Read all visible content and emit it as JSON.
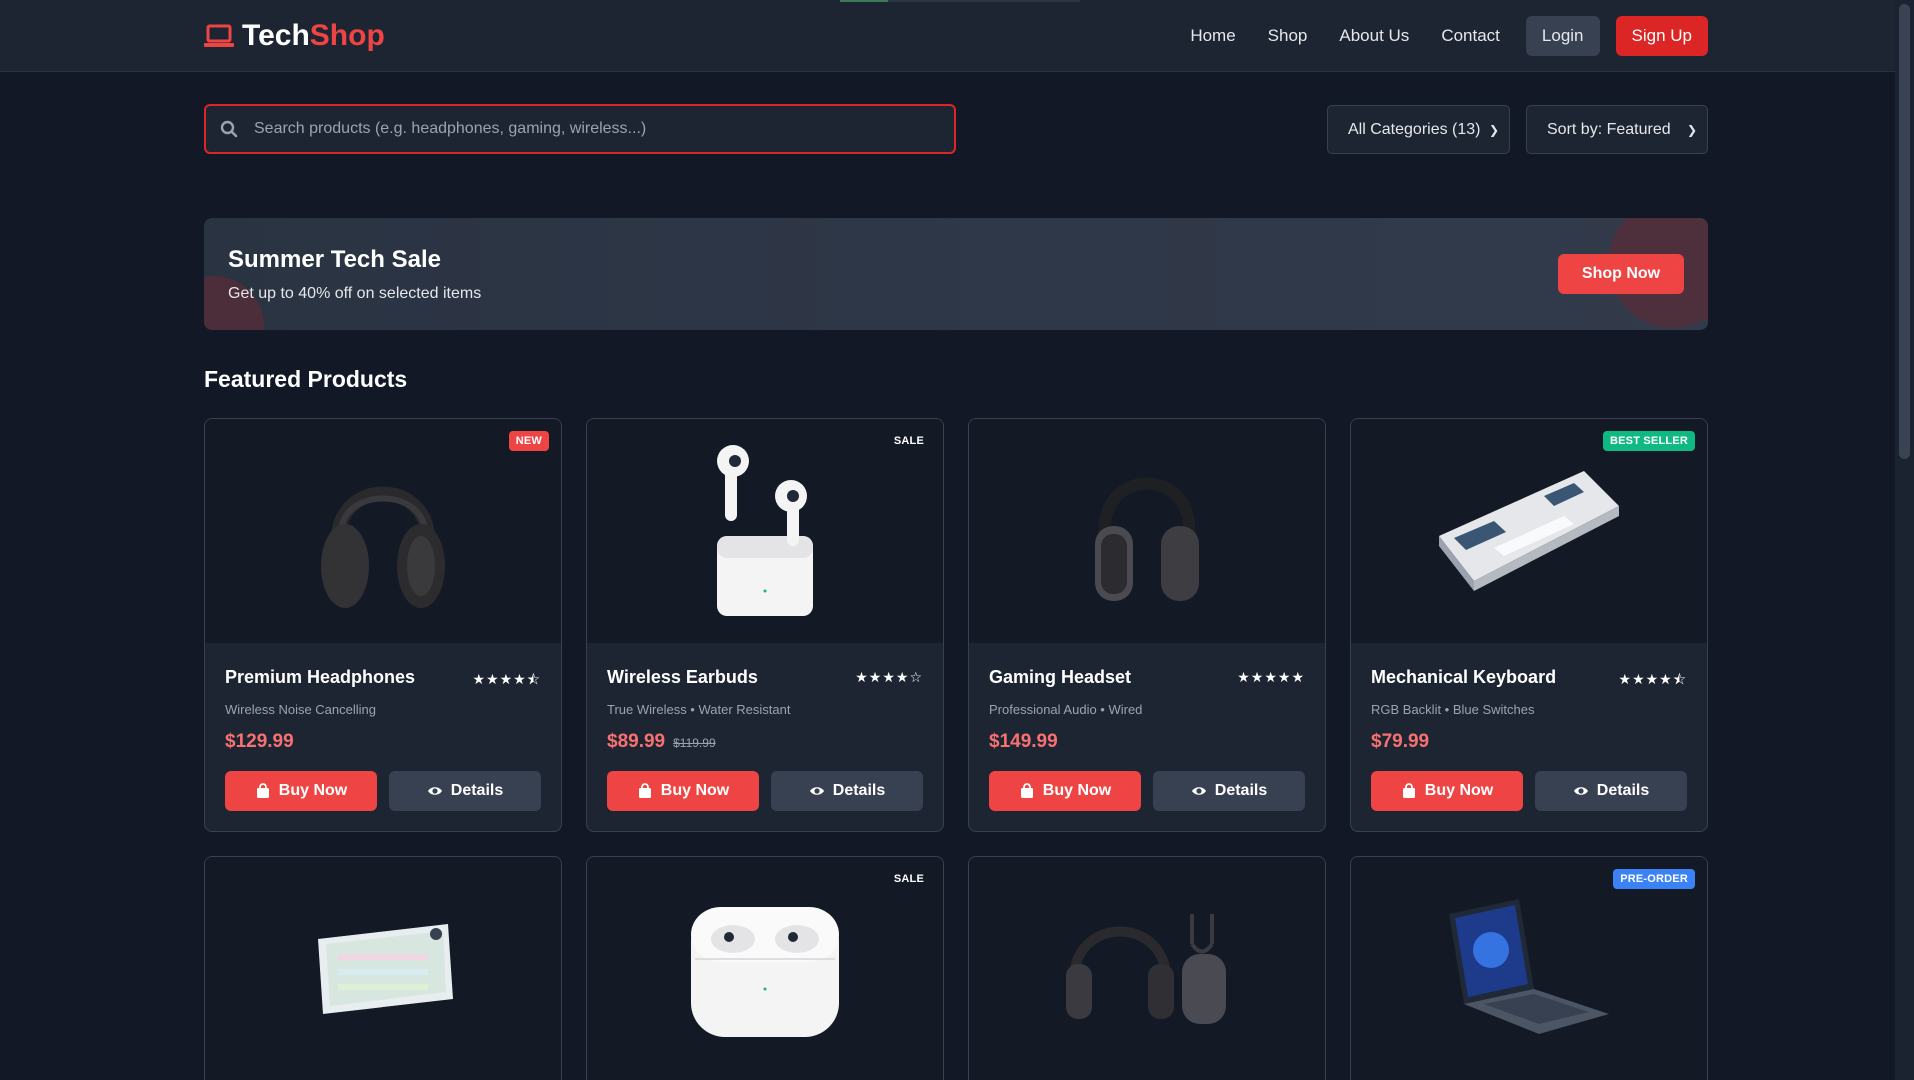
{
  "header": {
    "logo_part1": "Tech",
    "logo_part2": "Shop",
    "nav": [
      "Home",
      "Shop",
      "About Us",
      "Contact"
    ],
    "login_label": "Login",
    "signup_label": "Sign Up"
  },
  "search": {
    "placeholder": "Search products (e.g. headphones, gaming, wireless...)"
  },
  "filters": {
    "category": "All Categories (13)",
    "sort": "Sort by: Featured"
  },
  "banner": {
    "title": "Summer Tech Sale",
    "subtitle": "Get up to 40% off on selected items",
    "button": "Shop Now"
  },
  "section_title": "Featured Products",
  "buy_label": "Buy Now",
  "details_label": "Details",
  "products": [
    {
      "name": "Premium Headphones",
      "desc": "Wireless Noise Cancelling",
      "price": "$129.99",
      "old_price": "",
      "badge": "NEW",
      "badge_color": "#ef4444",
      "stars": "★★★★⯪",
      "rating": 4.5
    },
    {
      "name": "Wireless Earbuds",
      "desc": "True Wireless • Water Resistant",
      "price": "$89.99",
      "old_price": "$119.99",
      "badge": "SALE",
      "badge_color": "transparent",
      "stars": "★★★★☆",
      "rating": 4
    },
    {
      "name": "Gaming Headset",
      "desc": "Professional Audio • Wired",
      "price": "$149.99",
      "old_price": "",
      "badge": "",
      "badge_color": "transparent",
      "stars": "★★★★★",
      "rating": 5
    },
    {
      "name": "Mechanical Keyboard",
      "desc": "RGB Backlit • Blue Switches",
      "price": "$79.99",
      "old_price": "",
      "badge": "BEST SELLER",
      "badge_color": "#10b981",
      "stars": "★★★★⯪",
      "rating": 4.5
    }
  ],
  "products_row2": [
    {
      "badge": "",
      "badge_color": "transparent"
    },
    {
      "badge": "SALE",
      "badge_color": "transparent"
    },
    {
      "badge": "",
      "badge_color": "transparent"
    },
    {
      "badge": "PRE-ORDER",
      "badge_color": "#3b82f6"
    }
  ],
  "colors": {
    "accent": "#ef4444",
    "background": "#121826",
    "card": "#1d2533"
  }
}
